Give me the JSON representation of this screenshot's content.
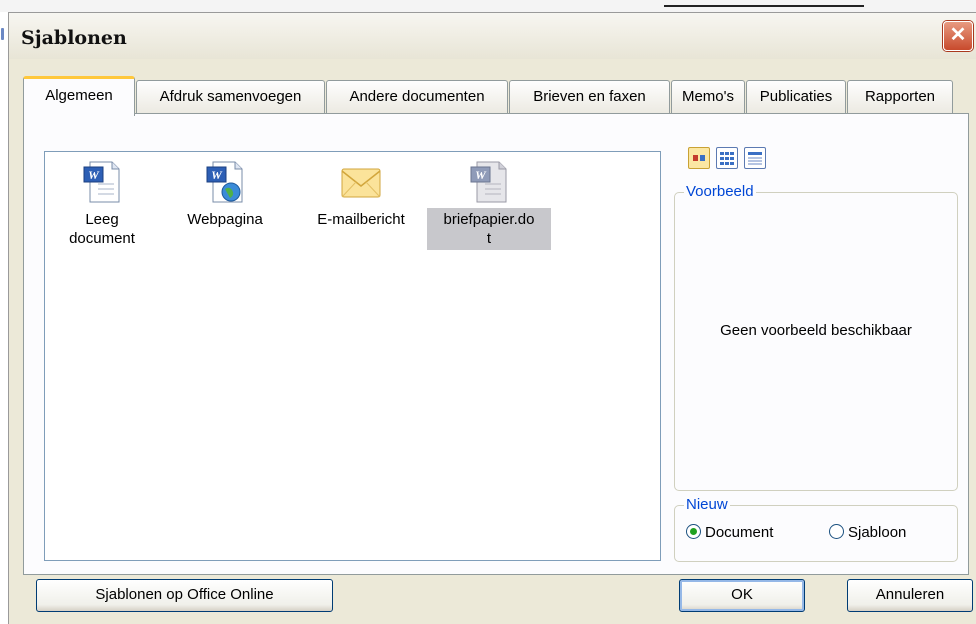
{
  "dialog": {
    "title": "Sjablonen",
    "close_symbol": "✕"
  },
  "tabs": [
    {
      "label": "Algemeen",
      "active": true
    },
    {
      "label": "Afdruk samenvoegen"
    },
    {
      "label": "Andere documenten"
    },
    {
      "label": "Brieven en faxen"
    },
    {
      "label": "Memo's"
    },
    {
      "label": "Publicaties"
    },
    {
      "label": "Rapporten"
    }
  ],
  "templates": [
    {
      "label": "Leeg\ndocument",
      "icon": "word-document-icon"
    },
    {
      "label": "Webpagina",
      "icon": "word-webpage-icon"
    },
    {
      "label": "E-mailbericht",
      "icon": "envelope-icon"
    },
    {
      "label": "briefpapier.do\nt",
      "icon": "word-template-icon",
      "selected": true
    }
  ],
  "view_buttons": [
    "large-icons-view-icon",
    "list-view-icon",
    "details-view-icon"
  ],
  "preview": {
    "label": "Voorbeeld",
    "empty_text": "Geen voorbeeld beschikbaar"
  },
  "new_group": {
    "label": "Nieuw",
    "options": [
      {
        "label": "Document",
        "checked": true
      },
      {
        "label": "Sjabloon",
        "checked": false
      }
    ]
  },
  "buttons": {
    "office_online": "Sjablonen op Office Online",
    "ok": "OK",
    "cancel": "Annuleren"
  },
  "colors": {
    "dialog_bg": "#ece9d8",
    "active_tab_accent": "#ffc83c",
    "group_label": "#0046d5",
    "close_button": "#c84a2c"
  }
}
